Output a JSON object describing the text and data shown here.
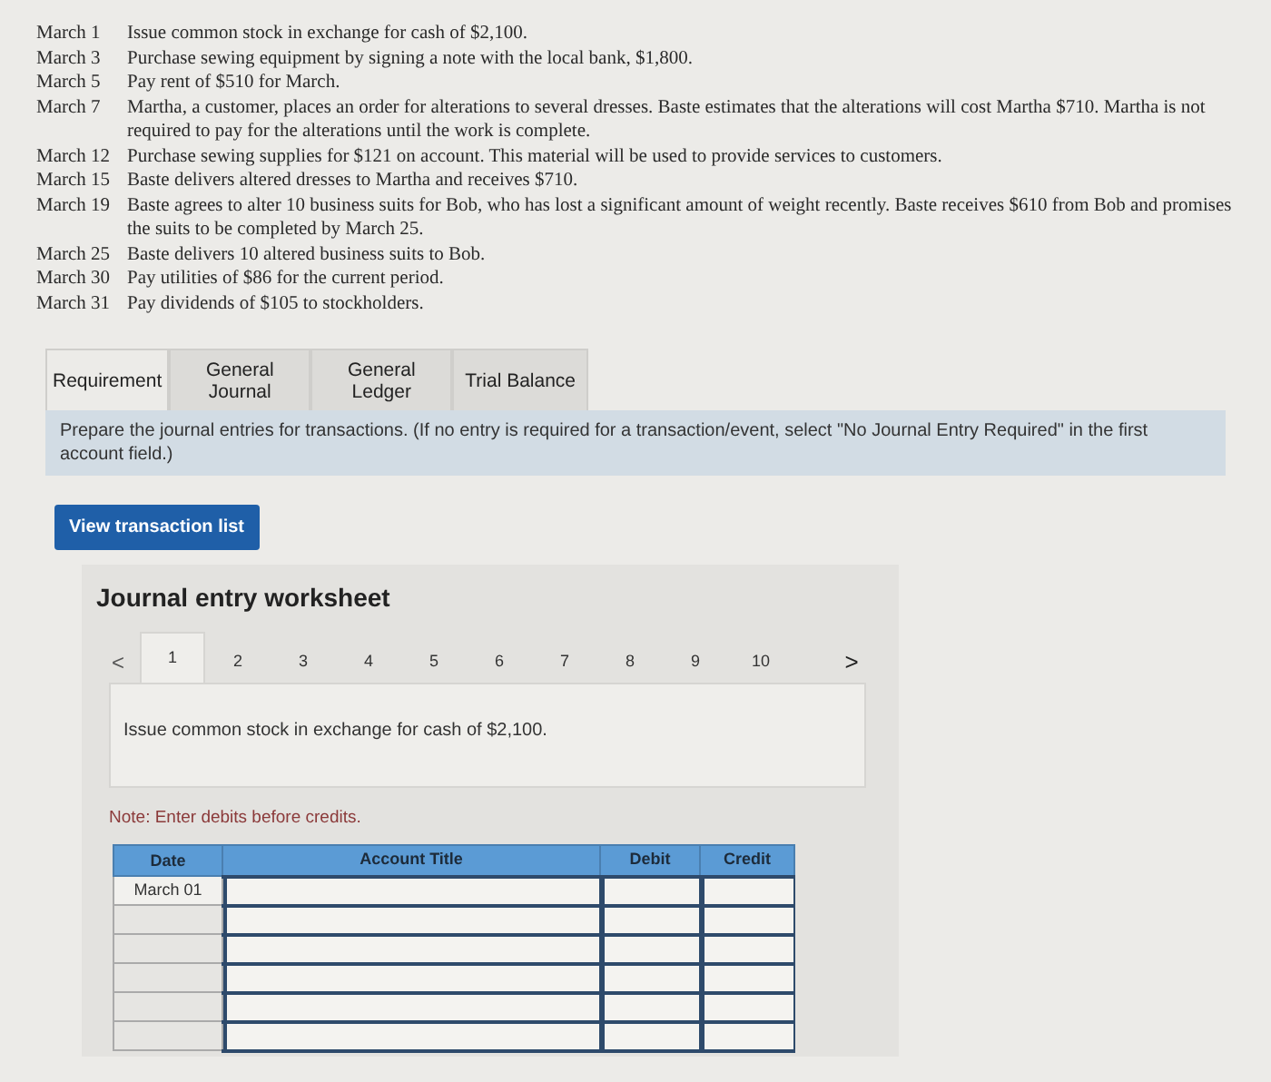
{
  "transactions": [
    {
      "date": "March 1",
      "text": "Issue common stock in exchange for cash of $2,100."
    },
    {
      "date": "March 3",
      "text": "Purchase sewing equipment by signing a note with the local bank, $1,800."
    },
    {
      "date": "March 5",
      "text": "Pay rent of $510 for March."
    },
    {
      "date": "March 7",
      "text": "Martha, a customer, places an order for alterations to several dresses. Baste estimates that the alterations will cost Martha $710. Martha is not required to pay for the alterations until the work is complete."
    },
    {
      "date": "March 12",
      "text": "Purchase sewing supplies for $121 on account. This material will be used to provide services to customers."
    },
    {
      "date": "March 15",
      "text": "Baste delivers altered dresses to Martha and receives $710."
    },
    {
      "date": "March 19",
      "text": "Baste agrees to alter 10 business suits for Bob, who has lost a significant amount of weight recently. Baste receives $610 from Bob and promises the suits to be completed by March 25."
    },
    {
      "date": "March 25",
      "text": "Baste delivers 10 altered business suits to Bob."
    },
    {
      "date": "March 30",
      "text": "Pay utilities of $86 for the current period."
    },
    {
      "date": "March 31",
      "text": "Pay dividends of $105 to stockholders."
    }
  ],
  "tabs": [
    {
      "label": "Requirement",
      "selected": true
    },
    {
      "label": "General Journal",
      "selected": false
    },
    {
      "label": "General Ledger",
      "selected": false
    },
    {
      "label": "Trial Balance",
      "selected": false
    }
  ],
  "instructions": "Prepare the journal entries for transactions. (If no entry is required for a transaction/event, select \"No Journal Entry Required\" in the first account field.)",
  "view_button": "View transaction list",
  "worksheet": {
    "title": "Journal entry worksheet",
    "prev": "<",
    "next": ">",
    "pages": [
      {
        "label": "1",
        "selected": true
      },
      {
        "label": "2",
        "selected": false
      },
      {
        "label": "3",
        "selected": false
      },
      {
        "label": "4",
        "selected": false
      },
      {
        "label": "5",
        "selected": false
      },
      {
        "label": "6",
        "selected": false
      },
      {
        "label": "7",
        "selected": false
      },
      {
        "label": "8",
        "selected": false
      },
      {
        "label": "9",
        "selected": false
      },
      {
        "label": "10",
        "selected": false
      }
    ],
    "description": "Issue common stock in exchange for cash of $2,100.",
    "note": "Note: Enter debits before credits.",
    "columns": [
      "Date",
      "Account Title",
      "Debit",
      "Credit"
    ],
    "rows": [
      {
        "kind": "dated",
        "date": "March 01"
      },
      {
        "kind": "blank"
      },
      {
        "kind": "blank"
      },
      {
        "kind": "blank"
      },
      {
        "kind": "blank"
      },
      {
        "kind": "blank"
      }
    ]
  }
}
